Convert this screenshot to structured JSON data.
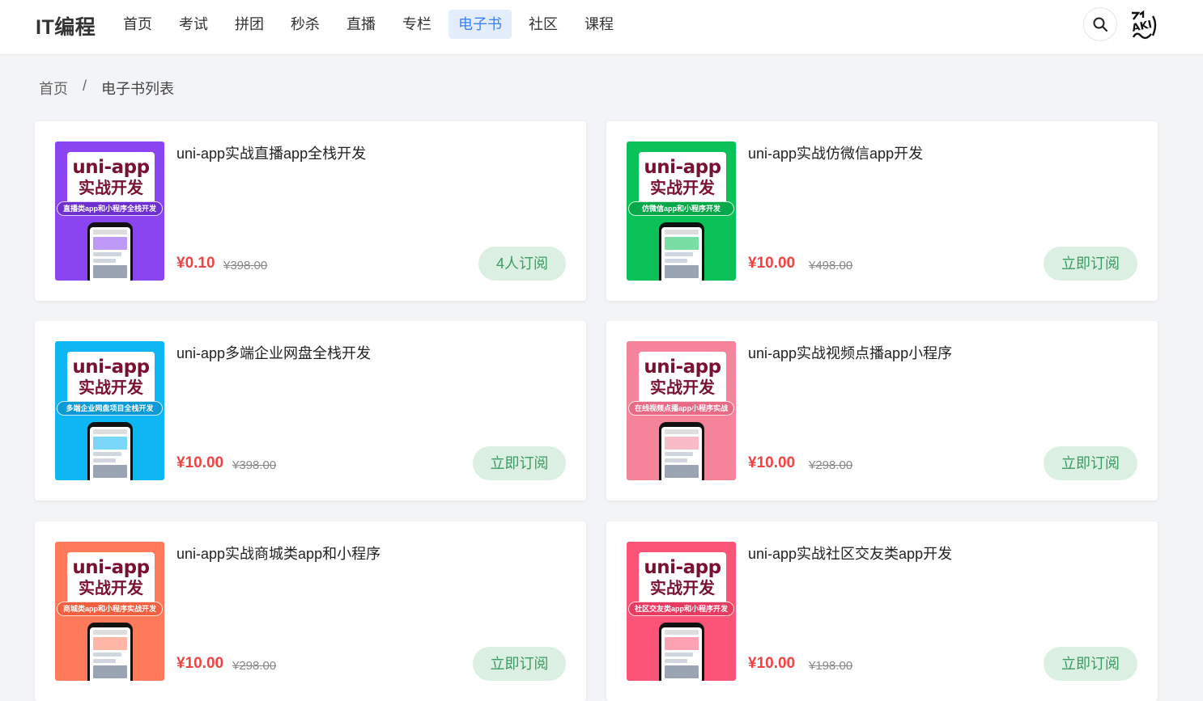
{
  "header": {
    "logo": "IT编程",
    "nav": [
      "首页",
      "考试",
      "拼团",
      "秒杀",
      "直播",
      "专栏",
      "电子书",
      "社区",
      "课程"
    ],
    "active_nav": "电子书",
    "avatar_text": "AKI"
  },
  "breadcrumb": {
    "home": "首页",
    "separator": "/",
    "current": "电子书列表"
  },
  "books": [
    {
      "title": "uni-app实战直播app全栈开发",
      "price": "¥0.10",
      "original_price": "¥398.00",
      "button": "4人订阅",
      "cover": {
        "line1": "uni-app",
        "line2": "实战开发",
        "band": "直播类app和小程序全栈开发",
        "color": "#8b45f0",
        "band_color": "#6e2fd1"
      }
    },
    {
      "title": "uni-app实战仿微信app开发",
      "price": "¥10.00",
      "original_price": "¥498.00",
      "button": "立即订阅",
      "cover": {
        "line1": "uni-app",
        "line2": "实战开发",
        "band": "仿微信app和小程序开发",
        "color": "#0ac258",
        "band_color": "#05a94a"
      }
    },
    {
      "title": "uni-app多端企业网盘全栈开发",
      "price": "¥10.00",
      "original_price": "¥398.00",
      "button": "立即订阅",
      "cover": {
        "line1": "uni-app",
        "line2": "实战开发",
        "band": "多端企业网盘项目全栈开发",
        "color": "#0fb6f4",
        "band_color": "#0a9bd6"
      }
    },
    {
      "title": "uni-app实战视频点播app小程序",
      "price": "¥10.00",
      "original_price": "¥298.00",
      "button": "立即订阅",
      "cover": {
        "line1": "uni-app",
        "line2": "实战开发",
        "band": "在线视频点播app小程序实战",
        "color": "#f5849b",
        "band_color": "#e86a85"
      }
    },
    {
      "title": "uni-app实战商城类app和小程序",
      "price": "¥10.00",
      "original_price": "¥298.00",
      "button": "立即订阅",
      "cover": {
        "line1": "uni-app",
        "line2": "实战开发",
        "band": "商城类app和小程序实战开发",
        "color": "#ff7a5a",
        "band_color": "#f0603f"
      }
    },
    {
      "title": "uni-app实战社区交友类app开发",
      "price": "¥10.00",
      "original_price": "¥198.00",
      "button": "立即订阅",
      "cover": {
        "line1": "uni-app",
        "line2": "实战开发",
        "band": "社区交友类app和小程序开发",
        "color": "#fc5478",
        "band_color": "#e83b61"
      }
    }
  ]
}
